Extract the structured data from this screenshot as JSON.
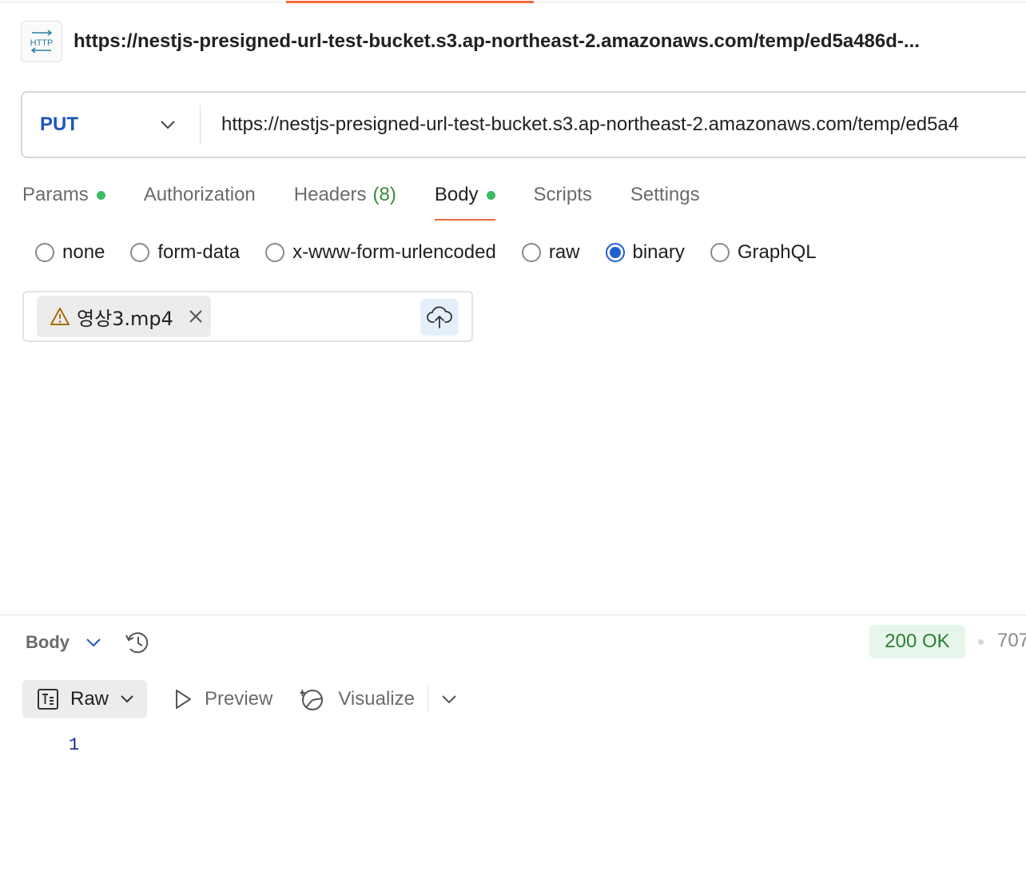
{
  "request": {
    "title": "https://nestjs-presigned-url-test-bucket.s3.ap-northeast-2.amazonaws.com/temp/ed5a486d-...",
    "method": "PUT",
    "url": "https://nestjs-presigned-url-test-bucket.s3.ap-northeast-2.amazonaws.com/temp/ed5a4"
  },
  "tabs": [
    {
      "label": "Params",
      "dot": true
    },
    {
      "label": "Authorization"
    },
    {
      "label": "Headers",
      "count": "(8)"
    },
    {
      "label": "Body",
      "dot": true,
      "active": true
    },
    {
      "label": "Scripts"
    },
    {
      "label": "Settings"
    }
  ],
  "body_types": [
    {
      "label": "none"
    },
    {
      "label": "form-data"
    },
    {
      "label": "x-www-form-urlencoded"
    },
    {
      "label": "raw"
    },
    {
      "label": "binary",
      "checked": true
    },
    {
      "label": "GraphQL"
    }
  ],
  "file": {
    "name": "영상3.mp4",
    "warning_color": "#a86b00"
  },
  "response": {
    "body_label": "Body",
    "status": "200 OK",
    "time_partial": "707",
    "view": {
      "raw": "Raw",
      "preview": "Preview",
      "visualize": "Visualize"
    },
    "line_number": "1"
  },
  "colors": {
    "accent": "#f26b3a",
    "method": "#1f56b9",
    "radio_checked": "#1f5fd1",
    "success": "#2e7d32"
  }
}
